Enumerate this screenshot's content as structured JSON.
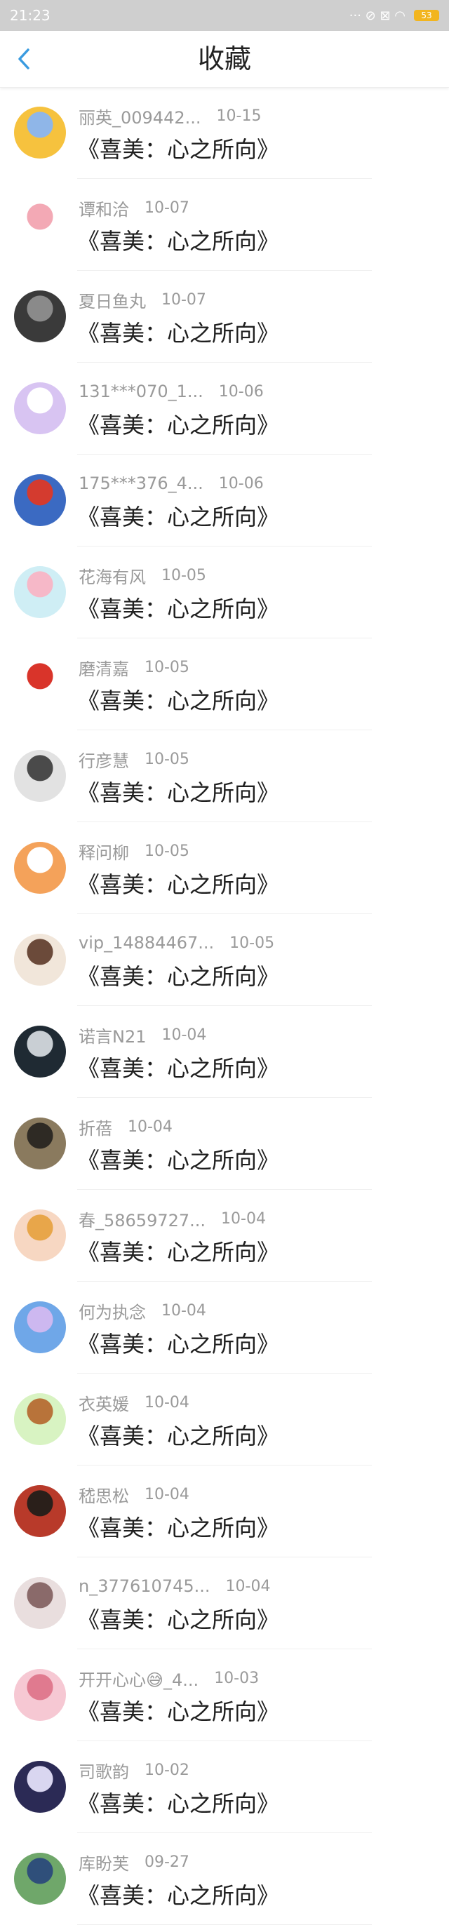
{
  "status_bar": {
    "time": "21:23",
    "icons": "··· ⊘ ⊠ ◠",
    "battery": "53"
  },
  "header": {
    "title": "收藏",
    "back_icon": "chevron-left-icon",
    "accent": "#3a9be0"
  },
  "items": [
    {
      "user": "丽英_009442...",
      "date": "10-15",
      "title": "《喜美：心之所向》",
      "avatar_colors": [
        "#f6c23e",
        "#8fb6e8"
      ]
    },
    {
      "user": "谭和洽",
      "date": "10-07",
      "title": "《喜美：心之所向》",
      "avatar_colors": [
        "#ffffff",
        "#f3a9b5"
      ]
    },
    {
      "user": "夏日鱼丸",
      "date": "10-07",
      "title": "《喜美：心之所向》",
      "avatar_colors": [
        "#3a3a3a",
        "#8a8a8a"
      ]
    },
    {
      "user": "131***070_1...",
      "date": "10-06",
      "title": "《喜美：心之所向》",
      "avatar_colors": [
        "#d8c4f2",
        "#ffffff"
      ]
    },
    {
      "user": "175***376_4...",
      "date": "10-06",
      "title": "《喜美：心之所向》",
      "avatar_colors": [
        "#3b6ac2",
        "#d43b2f"
      ]
    },
    {
      "user": "花海有风",
      "date": "10-05",
      "title": "《喜美：心之所向》",
      "avatar_colors": [
        "#cfeef5",
        "#f6b8c8"
      ]
    },
    {
      "user": "磨清嘉",
      "date": "10-05",
      "title": "《喜美：心之所向》",
      "avatar_colors": [
        "#ffffff",
        "#d9342a"
      ]
    },
    {
      "user": "行彦慧",
      "date": "10-05",
      "title": "《喜美：心之所向》",
      "avatar_colors": [
        "#e2e2e2",
        "#4a4a4a"
      ]
    },
    {
      "user": "释问柳",
      "date": "10-05",
      "title": "《喜美：心之所向》",
      "avatar_colors": [
        "#f4a25a",
        "#ffffff"
      ]
    },
    {
      "user": "vip_14884467...",
      "date": "10-05",
      "title": "《喜美：心之所向》",
      "avatar_colors": [
        "#f1e6da",
        "#6b4a3a"
      ]
    },
    {
      "user": "诺言N21",
      "date": "10-04",
      "title": "《喜美：心之所向》",
      "avatar_colors": [
        "#1f2a33",
        "#c9cfd4"
      ]
    },
    {
      "user": "折蓓",
      "date": "10-04",
      "title": "《喜美：心之所向》",
      "avatar_colors": [
        "#8a7a5e",
        "#2e2a24"
      ]
    },
    {
      "user": "春_58659727...",
      "date": "10-04",
      "title": "《喜美：心之所向》",
      "avatar_colors": [
        "#f7d7c2",
        "#e8a64a"
      ]
    },
    {
      "user": "何为执念",
      "date": "10-04",
      "title": "《喜美：心之所向》",
      "avatar_colors": [
        "#6fa7e8",
        "#cdb8f0"
      ]
    },
    {
      "user": "衣英媛",
      "date": "10-04",
      "title": "《喜美：心之所向》",
      "avatar_colors": [
        "#d8f3c2",
        "#b8733a"
      ]
    },
    {
      "user": "嵇思松",
      "date": "10-04",
      "title": "《喜美：心之所向》",
      "avatar_colors": [
        "#b83a2a",
        "#2a1f1a"
      ]
    },
    {
      "user": "n_377610745...",
      "date": "10-04",
      "title": "《喜美：心之所向》",
      "avatar_colors": [
        "#e9dede",
        "#8a6a6a"
      ]
    },
    {
      "user": "开开心心😅_4...",
      "date": "10-03",
      "title": "《喜美：心之所向》",
      "avatar_colors": [
        "#f6c8d3",
        "#e07a8f"
      ]
    },
    {
      "user": "司歌韵",
      "date": "10-02",
      "title": "《喜美：心之所向》",
      "avatar_colors": [
        "#2b2a55",
        "#d9d6f0"
      ]
    },
    {
      "user": "库盼芙",
      "date": "09-27",
      "title": "《喜美：心之所向》",
      "avatar_colors": [
        "#6fa76a",
        "#2f4f7a"
      ]
    }
  ]
}
